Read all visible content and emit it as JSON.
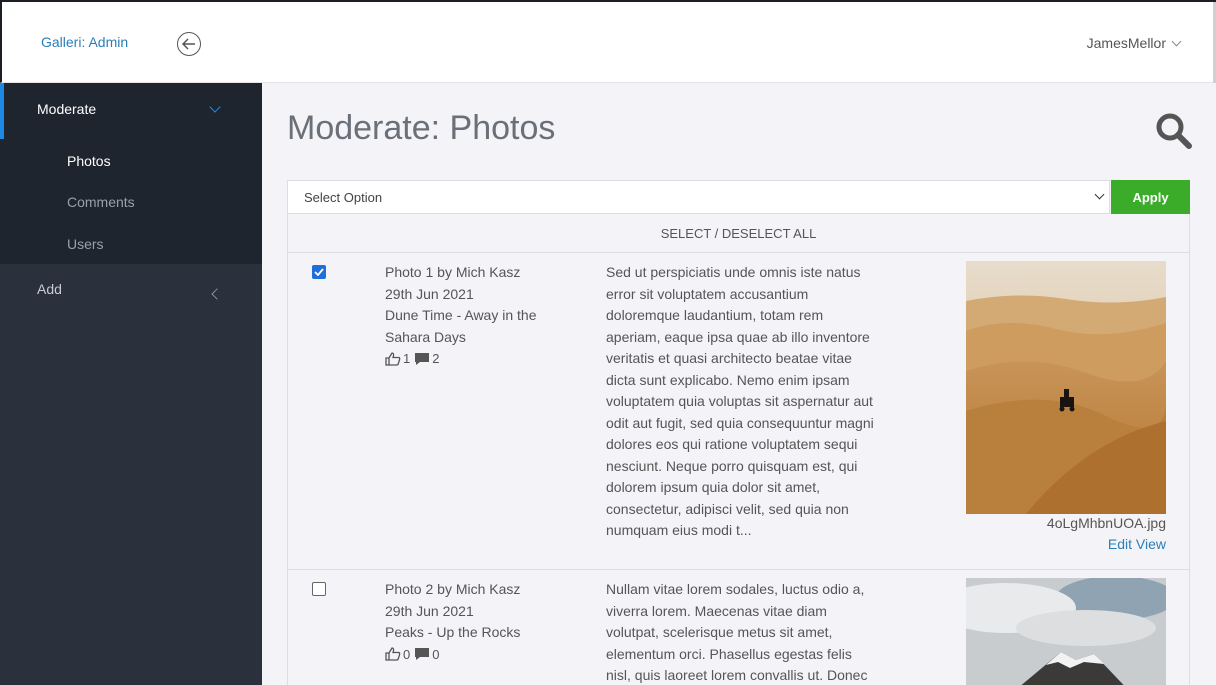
{
  "app": {
    "brand": "Galleri: Admin",
    "user": "JamesMellor"
  },
  "sidebar": {
    "section": "Moderate",
    "sub_items": [
      {
        "label": "Photos",
        "active": true
      },
      {
        "label": "Comments",
        "active": false
      },
      {
        "label": "Users",
        "active": false
      }
    ],
    "add": "Add"
  },
  "page": {
    "title": "Moderate: Photos",
    "select_placeholder": "Select Option",
    "apply_label": "Apply",
    "select_all_label": "SELECT / DESELECT ALL"
  },
  "rows": [
    {
      "checked": true,
      "title": "Photo 1 by Mich Kasz",
      "date": "29th Jun 2021",
      "caption": "Dune Time - Away in the Sahara Days",
      "likes": "1",
      "comments": "2",
      "description": "Sed ut perspiciatis unde omnis iste natus error sit voluptatem accusantium doloremque laudantium, totam rem aperiam, eaque ipsa quae ab illo inventore veritatis et quasi architecto beatae vitae dicta sunt explicabo. Nemo enim ipsam voluptatem quia voluptas sit aspernatur aut odit aut fugit, sed quia consequuntur magni dolores eos qui ratione voluptatem sequi nesciunt. Neque porro quisquam est, qui dolorem ipsum quia dolor sit amet, consectetur, adipisci velit, sed quia non numquam eius modi t...",
      "filename": "4oLgMhbnUOA.jpg",
      "actions": "Edit View"
    },
    {
      "checked": false,
      "title": "Photo 2 by Mich Kasz",
      "date": "29th Jun 2021",
      "caption": "Peaks - Up the Rocks",
      "likes": "0",
      "comments": "0",
      "description": "Nullam vitae lorem sodales, luctus odio a, viverra lorem. Maecenas vitae diam volutpat, scelerisque metus sit amet, elementum orci. Phasellus egestas felis nisl, quis laoreet lorem convallis ut. Donec"
    }
  ],
  "colors": {
    "accent": "#1e88e5",
    "link": "#2a7fb8",
    "apply": "#3aac2a",
    "sidebar": "#2a303c"
  }
}
